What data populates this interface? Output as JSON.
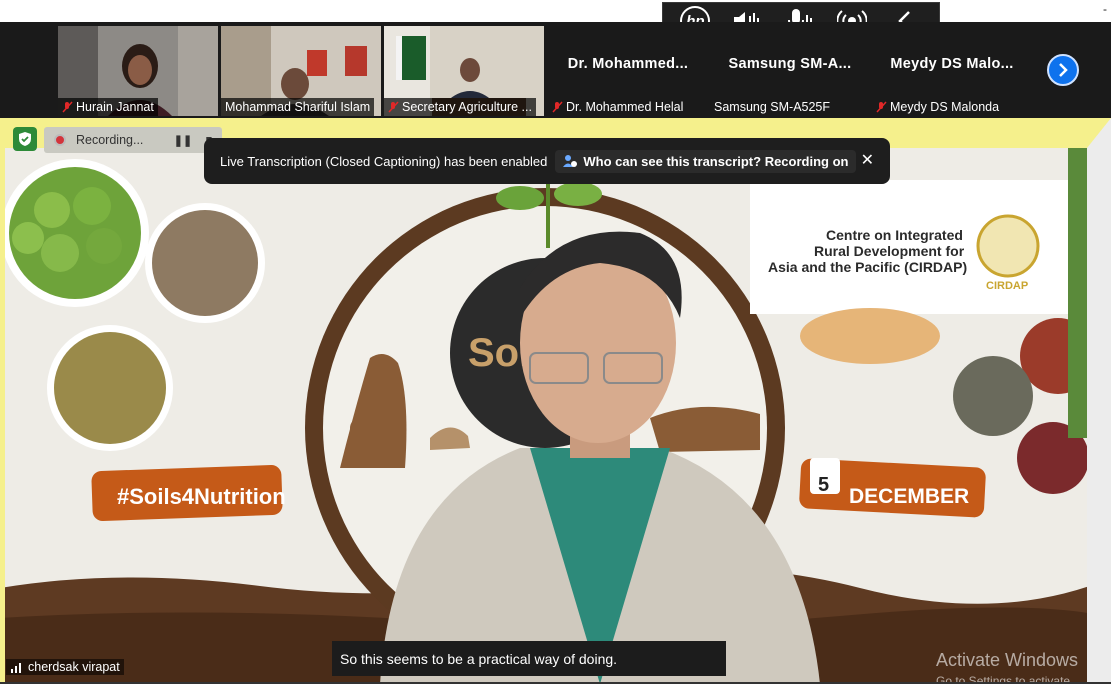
{
  "hp_toolbar": {
    "logo_text": "hp",
    "icons": [
      "speaker-icon",
      "microphone-icon",
      "broadcast-icon",
      "collapse-chevron-icon"
    ]
  },
  "participants": [
    {
      "name": "Hurain Jannat",
      "muted": true,
      "has_video": true
    },
    {
      "name": "Mohammad Shariful Islam",
      "muted": false,
      "has_video": true
    },
    {
      "name": "Secretary Agriculture ...",
      "muted": true,
      "has_video": true
    },
    {
      "display": "Dr.  Mohammed...",
      "name": "Dr. Mohammed Helal",
      "muted": true,
      "has_video": false
    },
    {
      "display": "Samsung  SM-A...",
      "name": "Samsung SM-A525F",
      "muted": false,
      "has_video": false
    },
    {
      "display": "Meydy  DS  Malo...",
      "name": "Meydy DS Malonda",
      "muted": true,
      "has_video": false
    }
  ],
  "recording": {
    "label": "Recording..."
  },
  "transcript_notice": {
    "text": "Live Transcription (Closed Captioning) has been enabled",
    "link": "Who can see this transcript? Recording on"
  },
  "background": {
    "hashtag": "#Soils4Nutrition",
    "date_day": "5",
    "date_month": "DECEMBER",
    "logo_title": "Centre on Integrated Rural Development for Asia and the Pacific (CIRDAP)",
    "logo_caption": "CIRDAP",
    "center_text": "Soi"
  },
  "caption": "So this seems to be a practical way of doing.",
  "active_speaker": "cherdsak virapat",
  "watermark": {
    "title": "Activate Windows",
    "subtitle": "Go to Settings to activate"
  },
  "colors": {
    "accent": "#0e72ed",
    "frame": "#f5f08c",
    "muted": "#e02828"
  }
}
